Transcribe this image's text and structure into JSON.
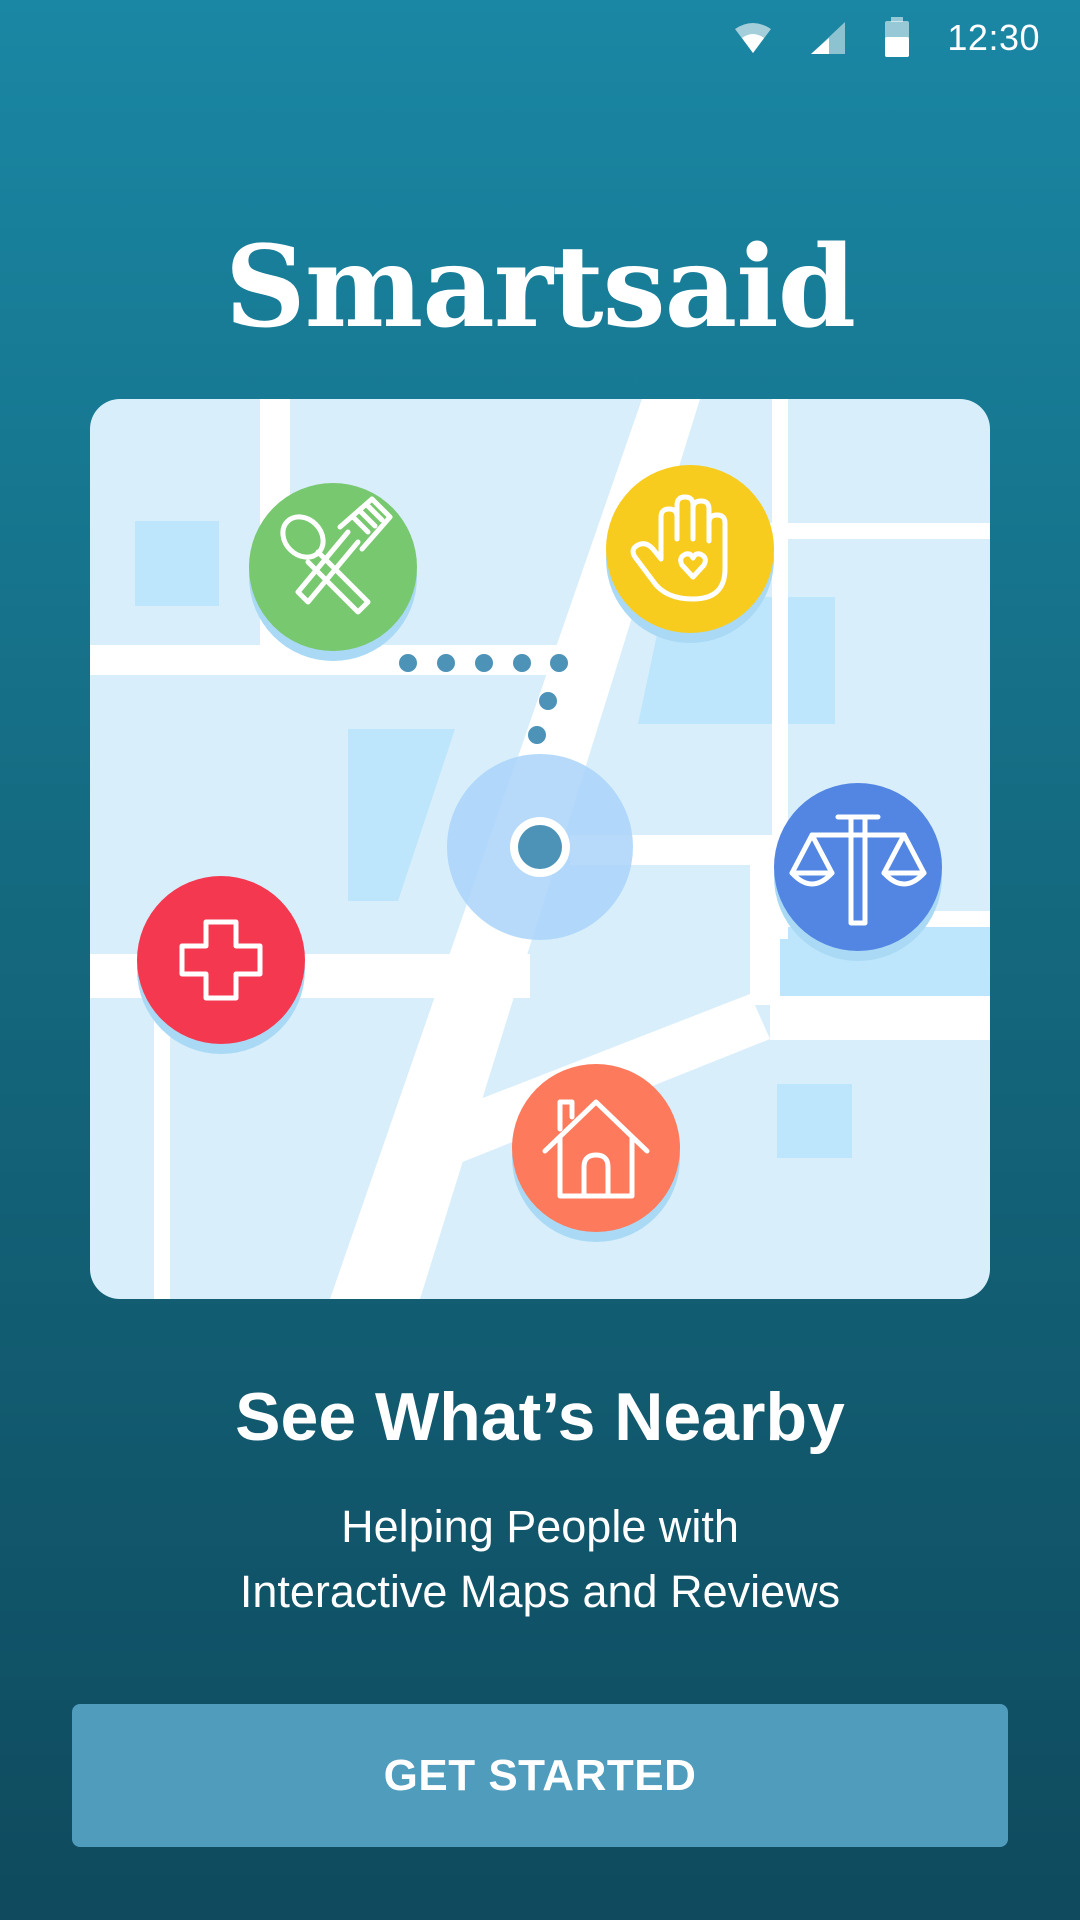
{
  "status_bar": {
    "time": "12:30",
    "icons": [
      "wifi-icon",
      "cellular-signal-icon",
      "battery-icon"
    ]
  },
  "app": {
    "title": "Smartsaid"
  },
  "map": {
    "categories": [
      {
        "name": "food",
        "icon": "fork-spoon-icon",
        "color": "#78c86f"
      },
      {
        "name": "support",
        "icon": "hand-heart-icon",
        "color": "#f7cc1e"
      },
      {
        "name": "legal",
        "icon": "scales-icon",
        "color": "#5286e2"
      },
      {
        "name": "health",
        "icon": "medical-cross-icon",
        "color": "#f4384f"
      },
      {
        "name": "housing",
        "icon": "house-icon",
        "color": "#fd7a5c"
      }
    ],
    "location_marker_color": "#4d93b8"
  },
  "onboarding": {
    "headline": "See What’s Nearby",
    "subtitle_line1": "Helping People with",
    "subtitle_line2": "Interactive Maps and Reviews"
  },
  "cta": {
    "label": "GET STARTED"
  },
  "colors": {
    "background_top": "#1a87a4",
    "background_bottom": "#0f4a5e",
    "button": "#4f9cbd",
    "map_background": "#d8eefb"
  }
}
